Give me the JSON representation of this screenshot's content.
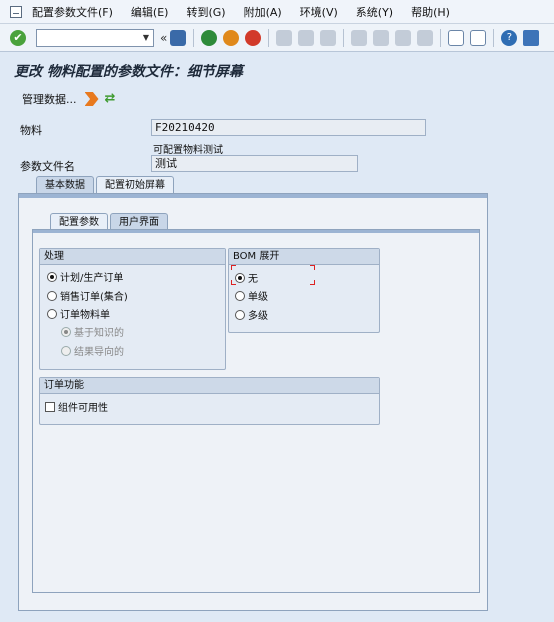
{
  "menu": {
    "items": [
      "配置参数文件(F)",
      "编辑(E)",
      "转到(G)",
      "附加(A)",
      "环境(V)",
      "系统(Y)",
      "帮助(H)"
    ]
  },
  "toolbar": {
    "command_value": "",
    "double_arrow": "«",
    "ok_glyph": "✔",
    "help_glyph": "?",
    "icons": [
      "ok-icon",
      "save-icon",
      "back-icon",
      "exit-icon",
      "cancel-icon",
      "print-icon",
      "find-icon",
      "find-next-icon",
      "first-page-icon",
      "prev-page-icon",
      "next-page-icon",
      "last-page-icon",
      "new-session-icon",
      "shortcut-icon",
      "help-icon",
      "layout-icon"
    ]
  },
  "page": {
    "title": "更改 物料配置的参数文件：细节屏幕"
  },
  "app_toolbar": {
    "manage_label": "管理数据..."
  },
  "form": {
    "material_label": "物料",
    "material_value": "F20210420",
    "material_desc": "可配置物料测试",
    "profile_label": "参数文件名",
    "profile_value": "测试"
  },
  "outer_tabs": [
    {
      "label": "基本数据",
      "active": false
    },
    {
      "label": "配置初始屏幕",
      "active": true
    }
  ],
  "inner_tabs": [
    {
      "label": "配置参数",
      "active": true
    },
    {
      "label": "用户界面",
      "active": false
    }
  ],
  "processing": {
    "title": "处理",
    "options": [
      "计划/生产订单",
      "销售订单(集合)",
      "订单物料单"
    ],
    "selected": 0,
    "sub_options": [
      "基于知识的",
      "结果导向的"
    ],
    "sub_selected": 0
  },
  "bom": {
    "title": "BOM 展开",
    "options": [
      "无",
      "单级",
      "多级"
    ],
    "selected": 0
  },
  "order_functions": {
    "title": "订单功能",
    "checkbox_label": "组件可用性",
    "checked": false
  }
}
